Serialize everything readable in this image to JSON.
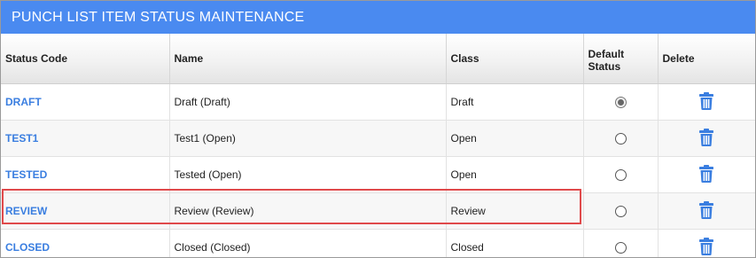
{
  "window": {
    "title": "PUNCH LIST ITEM STATUS MAINTENANCE"
  },
  "table": {
    "headers": {
      "status_code": "Status Code",
      "name": "Name",
      "class": "Class",
      "default_status": "Default\nStatus",
      "delete": "Delete"
    },
    "rows": [
      {
        "code": "DRAFT",
        "name": "Draft (Draft)",
        "class": "Draft",
        "default": true
      },
      {
        "code": "TEST1",
        "name": "Test1 (Open)",
        "class": "Open",
        "default": false
      },
      {
        "code": "TESTED",
        "name": "Tested (Open)",
        "class": "Open",
        "default": false
      },
      {
        "code": "REVIEW",
        "name": "Review (Review)",
        "class": "Review",
        "default": false,
        "highlighted": true
      },
      {
        "code": "CLOSED",
        "name": "Closed (Closed)",
        "class": "Closed",
        "default": false
      }
    ]
  },
  "icons": {
    "delete": "trash-icon",
    "radio": "radio-button-icon"
  },
  "colors": {
    "titlebar": "#4a8af0",
    "link": "#3a7ee0",
    "trash": "#3a7ee0",
    "highlight": "#e0494b"
  }
}
